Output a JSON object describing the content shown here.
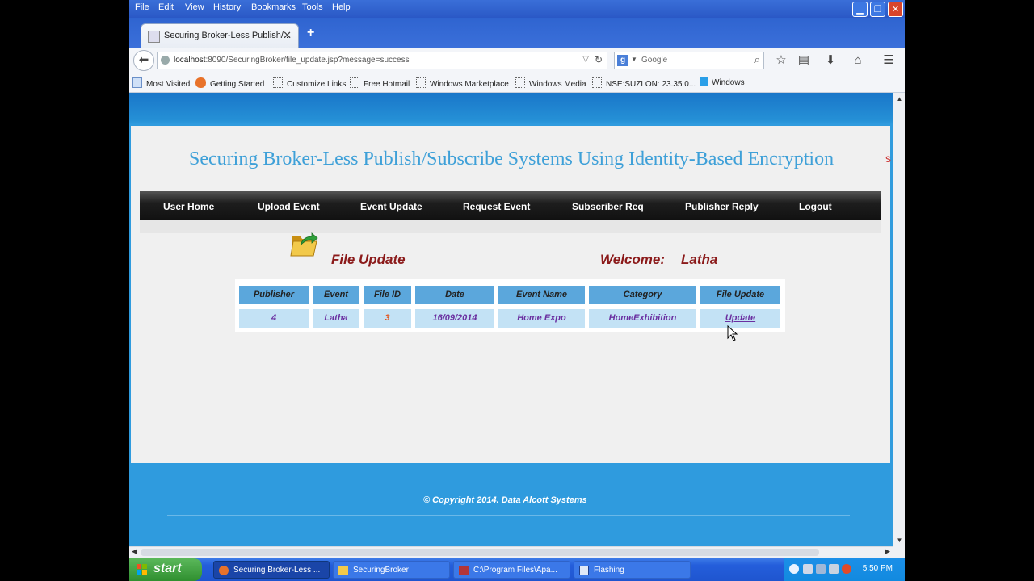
{
  "browser": {
    "menu": [
      "File",
      "Edit",
      "View",
      "History",
      "Bookmarks",
      "Tools",
      "Help"
    ],
    "tab_title": "Securing Broker-Less Publish/...",
    "url_host": "localhost",
    "url_rest": ":8090/SecuringBroker/file_update.jsp?message=success",
    "search_placeholder": "Google",
    "bookmarks": [
      "Most Visited",
      "Getting Started",
      "Customize Links",
      "Free Hotmail",
      "Windows Marketplace",
      "Windows Media",
      "NSE:SUZLON: 23.35 0...",
      "Windows"
    ]
  },
  "site": {
    "title": "Securing Broker-Less Publish/Subscribe Systems Using Identity-Based Encryption",
    "title_tail": "s",
    "nav": [
      "User Home",
      "Upload Event",
      "Event Update",
      "Request Event",
      "Subscriber Req",
      "Publisher Reply",
      "Logout"
    ],
    "page_heading": "File Update",
    "welcome_label": "Welcome:",
    "user_name": "Latha",
    "table": {
      "headers": [
        "Publisher",
        "Event",
        "File ID",
        "Date",
        "Event Name",
        "Category",
        "File Update"
      ],
      "row": [
        "4",
        "Latha",
        "3",
        "16/09/2014",
        "Home Expo",
        "HomeExhibition",
        "Update"
      ]
    },
    "copyright_prefix": "© Copyright 2014.",
    "copyright_link": "Data Alcott Systems"
  },
  "taskbar": {
    "start_label": "start",
    "tasks": [
      "Securing Broker-Less ...",
      "SecuringBroker",
      "C:\\Program Files\\Apa...",
      "Flashing"
    ],
    "clock": "5:50 PM"
  },
  "colors": {
    "accent_blue": "#2f9bde",
    "heading_red": "#8b1a1a",
    "table_header": "#5ba7dc",
    "table_cell": "#c3e2f5"
  }
}
